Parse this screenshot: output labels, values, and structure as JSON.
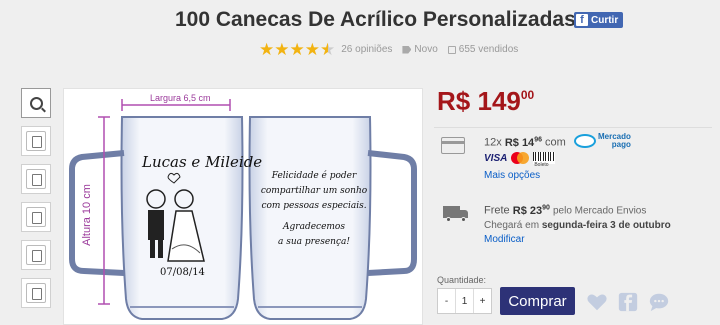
{
  "product": {
    "title": "100 Canecas De Acrílico Personalizadas",
    "like_label": "Curtir",
    "reviews": "26 opiniões",
    "condition": "Novo",
    "sold": "655 vendidos",
    "rating": 4.5
  },
  "image": {
    "width_label": "Largura 6,5 cm",
    "height_label": "Altura 10 cm",
    "names": "Lucas e Mileide",
    "date": "07/08/14",
    "message": [
      "Felicidade é poder",
      "compartilhar um sonho",
      "com pessoas especiais.",
      "Agradecemos",
      "a sua presença!"
    ]
  },
  "price": {
    "currency": "R$",
    "whole": "149",
    "cents": "00"
  },
  "payment": {
    "installments_prefix": "12x",
    "installment_currency": "R$",
    "installment_whole": "14",
    "installment_cents": "96",
    "with_label": "com",
    "provider_line1": "Mercado",
    "provider_line2": "pago",
    "visa": "VISA",
    "boleto": "Boleto",
    "more": "Mais opções"
  },
  "shipping": {
    "label": "Frete",
    "currency": "R$",
    "whole": "23",
    "cents": "90",
    "via": "pelo Mercado Envios",
    "arrival_prefix": "Chegará em",
    "arrival_day": "segunda-feira 3 de outubro",
    "modify": "Modificar"
  },
  "purchase": {
    "quantity_label": "Quantidade:",
    "minus": "-",
    "quantity": "1",
    "plus": "+",
    "buy_label": "Comprar"
  },
  "colors": {
    "price": "#a4161a",
    "buy_button": "#2d3277",
    "link": "#0a5ec7",
    "star": "#f2b311"
  }
}
